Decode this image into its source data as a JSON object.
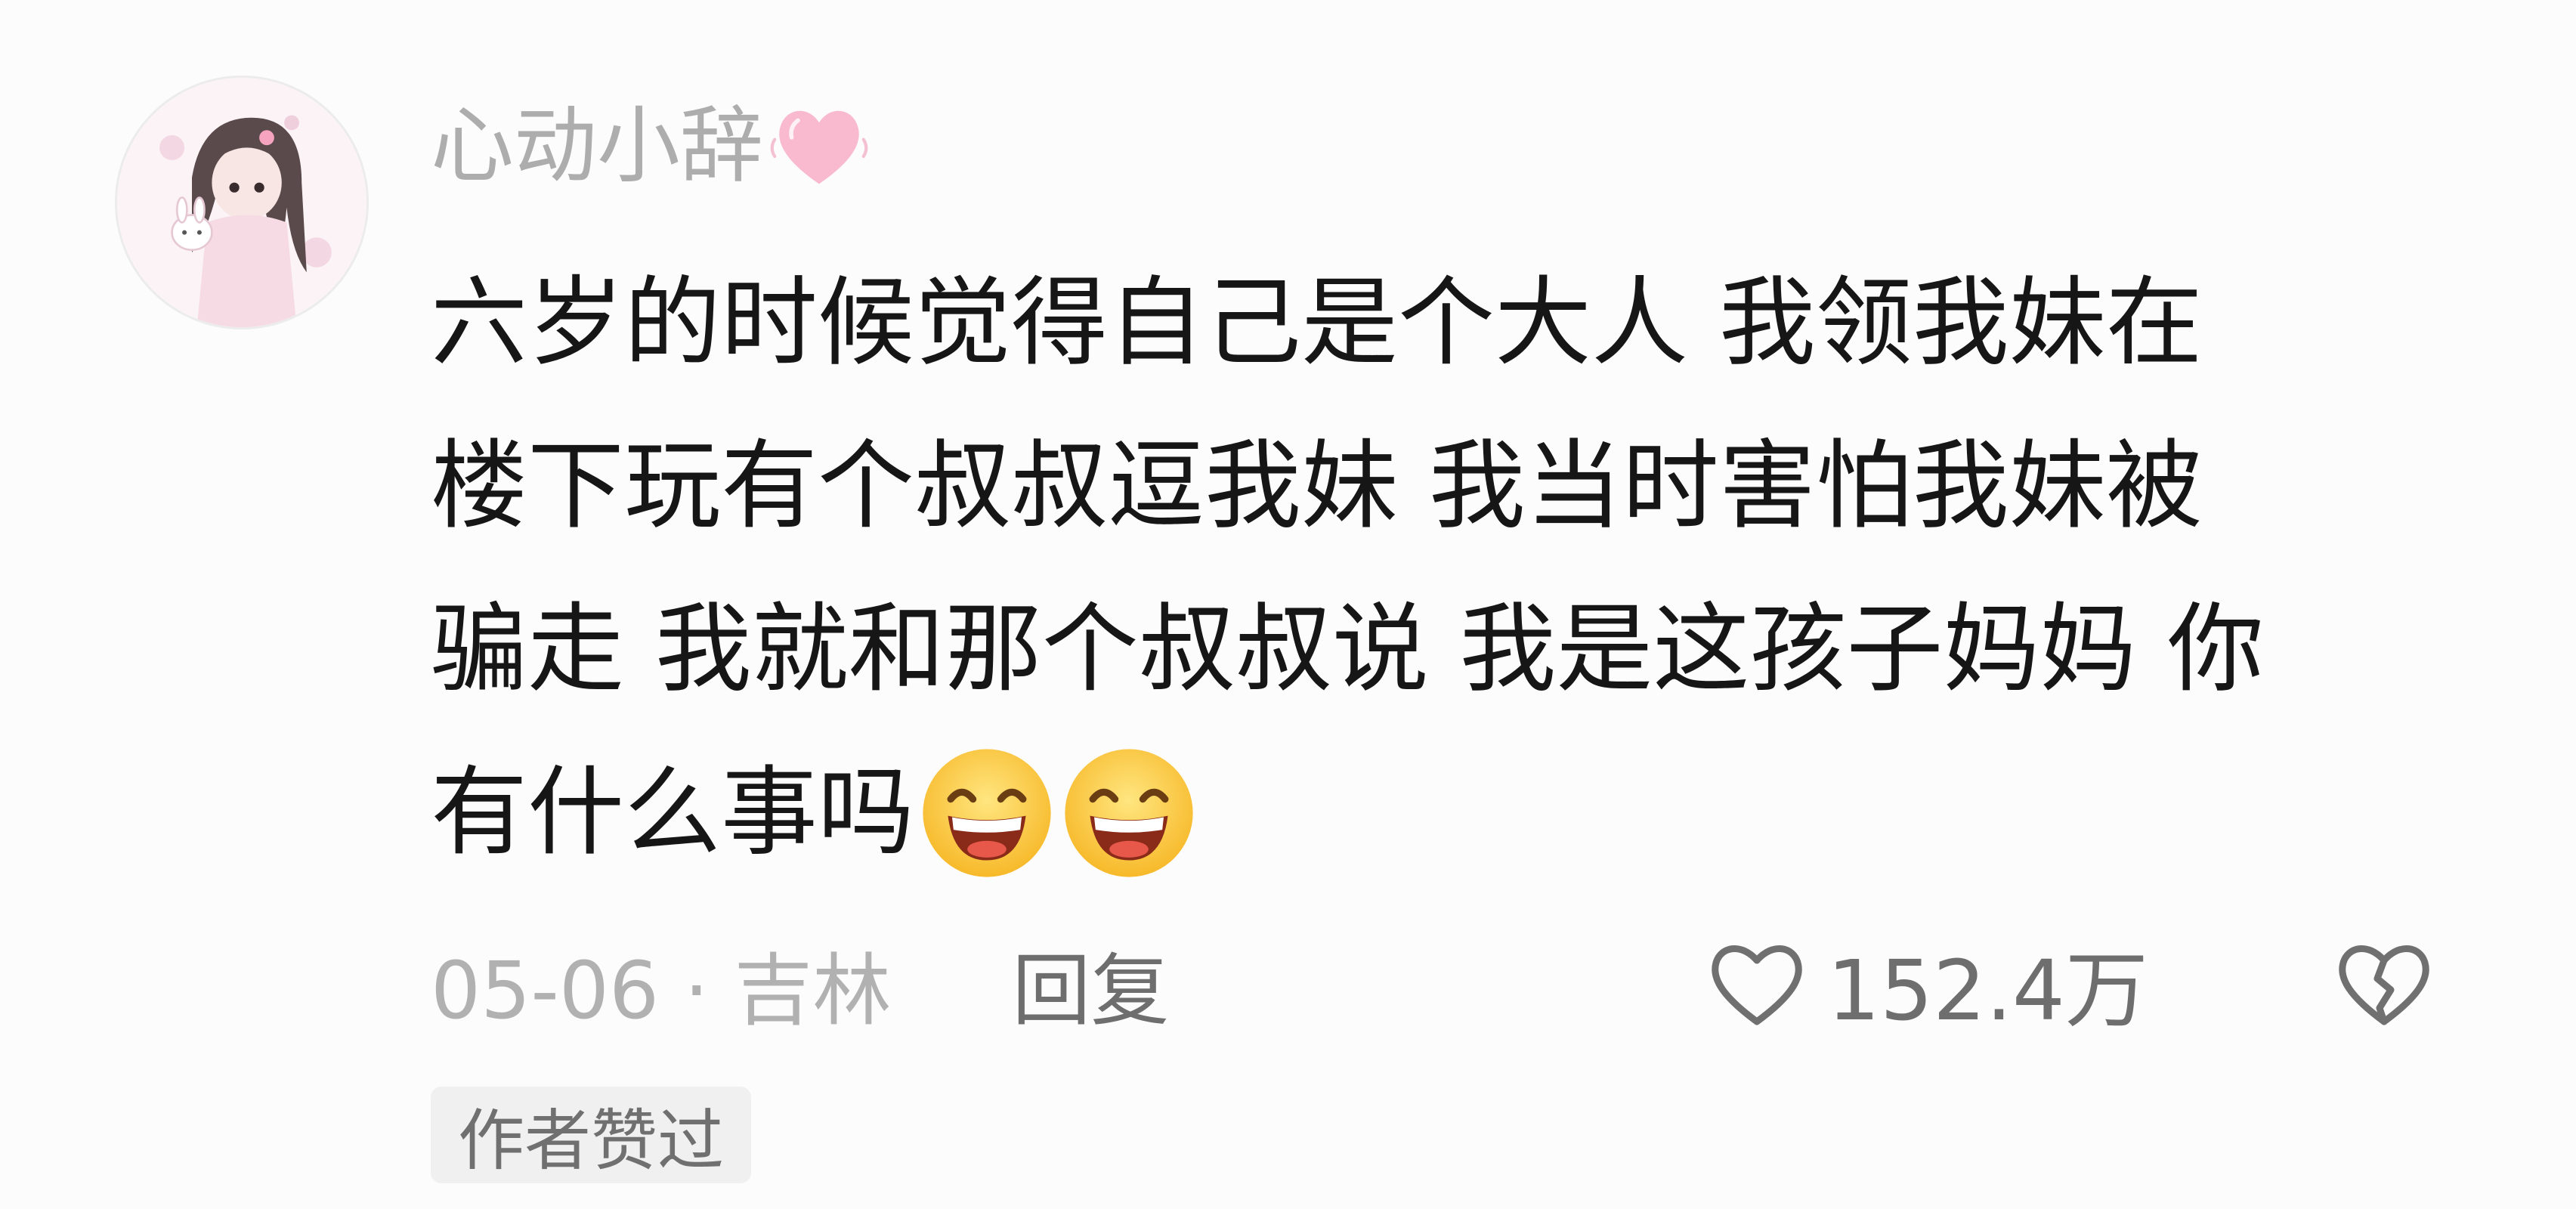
{
  "comment": {
    "username": "心动小辞",
    "username_emoji": "pink-heart-emoji",
    "body_lines": [
      "六岁的时候觉得自己是个大人 我领我妹在",
      "楼下玩有个叔叔逗我妹 我当时害怕我妹被",
      "骗走 我就和那个叔叔说 我是这孩子妈妈 你",
      "有什么事吗"
    ],
    "trailing_emojis": [
      "grinning-face-emoji",
      "grinning-face-emoji"
    ],
    "date_location": "05-06 · 吉林",
    "reply_label": "回复",
    "like_count": "152.4万",
    "author_badge": "作者赞过"
  },
  "icons": {
    "like": "heart-outline-icon",
    "dislike": "broken-heart-icon"
  },
  "colors": {
    "background": "#fcfcfc",
    "username": "#adadad",
    "body_text": "#161616",
    "meta_text": "#b1b1b1",
    "action_text": "#6e6e6e",
    "badge_bg": "#f0f0f0"
  }
}
